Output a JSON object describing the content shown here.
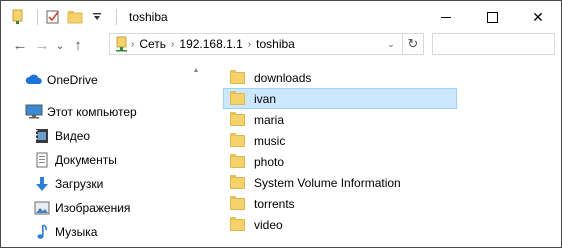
{
  "window": {
    "title": "toshiba",
    "controls": {
      "minimize": "—",
      "maximize": "☐",
      "close": "✕"
    }
  },
  "toolbar": {
    "back_glyph": "←",
    "forward_glyph": "→",
    "recent_glyph": "⌄",
    "up_glyph": "↑"
  },
  "address": {
    "crumbs": [
      "Сеть",
      "192.168.1.1",
      "toshiba"
    ],
    "separator": "›",
    "dropdown_glyph": "⌄",
    "refresh_glyph": "↻"
  },
  "search": {
    "placeholder": ""
  },
  "nav": {
    "items": [
      {
        "label": "OneDrive",
        "icon": "cloud-icon"
      },
      {
        "label": "Этот компьютер",
        "icon": "computer-icon"
      },
      {
        "label": "Видео",
        "icon": "video-icon"
      },
      {
        "label": "Документы",
        "icon": "documents-icon"
      },
      {
        "label": "Загрузки",
        "icon": "downloads-icon"
      },
      {
        "label": "Изображения",
        "icon": "pictures-icon"
      },
      {
        "label": "Музыка",
        "icon": "music-icon"
      }
    ],
    "scroll_up_glyph": "▲"
  },
  "files": [
    {
      "name": "downloads",
      "selected": false
    },
    {
      "name": "ivan",
      "selected": true
    },
    {
      "name": "maria",
      "selected": false
    },
    {
      "name": "music",
      "selected": false
    },
    {
      "name": "photo",
      "selected": false
    },
    {
      "name": "System Volume Information",
      "selected": false
    },
    {
      "name": "torrents",
      "selected": false
    },
    {
      "name": "video",
      "selected": false
    }
  ],
  "colors": {
    "selection": "#cce8ff",
    "selection_border": "#99d1ff",
    "folder": "#f6d26b",
    "onedrive": "#1e74d6"
  }
}
